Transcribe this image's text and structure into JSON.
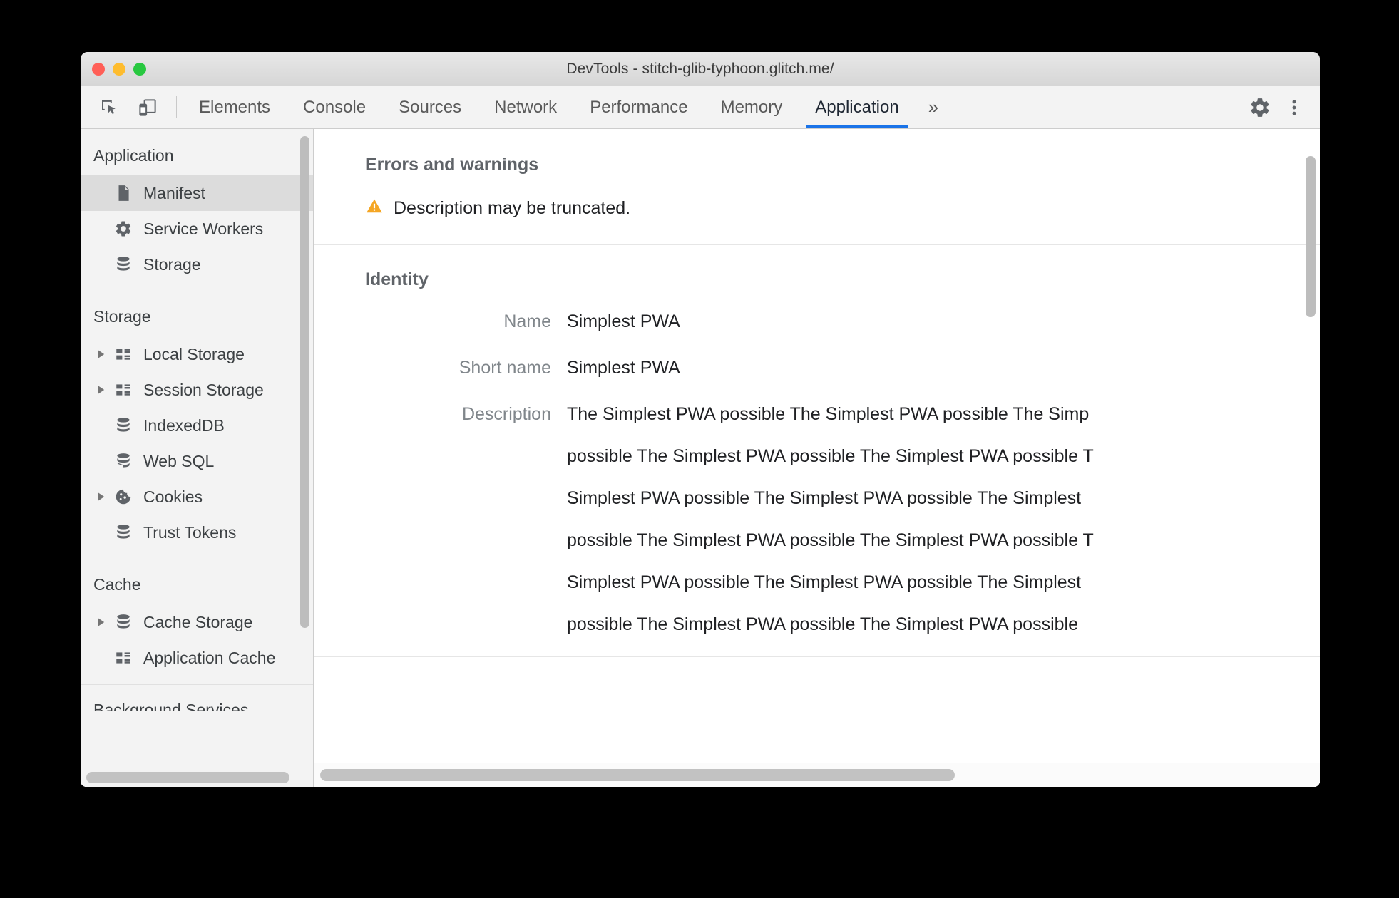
{
  "window": {
    "title": "DevTools - stitch-glib-typhoon.glitch.me/",
    "controls": {
      "close": "close",
      "minimize": "minimize",
      "maximize": "maximize"
    }
  },
  "toolbar": {
    "inspect_icon": "inspect-element-icon",
    "device_icon": "device-toolbar-icon",
    "more_tabs_label": "»",
    "settings_icon": "gear-icon",
    "menu_icon": "kebab-menu-icon",
    "tabs": [
      {
        "label": "Elements",
        "active": false
      },
      {
        "label": "Console",
        "active": false
      },
      {
        "label": "Sources",
        "active": false
      },
      {
        "label": "Network",
        "active": false
      },
      {
        "label": "Performance",
        "active": false
      },
      {
        "label": "Memory",
        "active": false
      },
      {
        "label": "Application",
        "active": true
      }
    ]
  },
  "sidebar": {
    "groups": [
      {
        "title": "Application",
        "items": [
          {
            "label": "Manifest",
            "icon": "document-icon",
            "selected": true,
            "expandable": false
          },
          {
            "label": "Service Workers",
            "icon": "gear-icon",
            "selected": false,
            "expandable": false
          },
          {
            "label": "Storage",
            "icon": "database-icon",
            "selected": false,
            "expandable": false
          }
        ]
      },
      {
        "title": "Storage",
        "items": [
          {
            "label": "Local Storage",
            "icon": "table-icon",
            "selected": false,
            "expandable": true
          },
          {
            "label": "Session Storage",
            "icon": "table-icon",
            "selected": false,
            "expandable": true
          },
          {
            "label": "IndexedDB",
            "icon": "database-icon",
            "selected": false,
            "expandable": false
          },
          {
            "label": "Web SQL",
            "icon": "database-icon",
            "selected": false,
            "expandable": false
          },
          {
            "label": "Cookies",
            "icon": "cookie-icon",
            "selected": false,
            "expandable": true
          },
          {
            "label": "Trust Tokens",
            "icon": "database-icon",
            "selected": false,
            "expandable": false
          }
        ]
      },
      {
        "title": "Cache",
        "items": [
          {
            "label": "Cache Storage",
            "icon": "database-icon",
            "selected": false,
            "expandable": true
          },
          {
            "label": "Application Cache",
            "icon": "table-icon",
            "selected": false,
            "expandable": false
          }
        ]
      },
      {
        "title": "Background Services",
        "items": []
      }
    ]
  },
  "main": {
    "errors_section": {
      "title": "Errors and warnings",
      "warning_icon": "warning-triangle-icon",
      "message": "Description may be truncated."
    },
    "identity_section": {
      "title": "Identity",
      "fields": [
        {
          "label": "Name",
          "value": "Simplest PWA"
        },
        {
          "label": "Short name",
          "value": "Simplest PWA"
        }
      ],
      "description_label": "Description",
      "description_lines": [
        "The Simplest PWA possible The Simplest PWA possible The Simp",
        "possible The Simplest PWA possible The Simplest PWA possible T",
        "Simplest PWA possible The Simplest PWA possible The Simplest",
        "possible The Simplest PWA possible The Simplest PWA possible T",
        "Simplest PWA possible The Simplest PWA possible The Simplest",
        "possible The Simplest PWA possible The Simplest PWA possible"
      ]
    }
  },
  "colors": {
    "accent": "#1a73e8",
    "warning": "#f5a623",
    "text": "#202124",
    "muted": "#80868b",
    "sidebar_bg": "#f3f3f3",
    "selected_bg": "#dcdcdc"
  }
}
